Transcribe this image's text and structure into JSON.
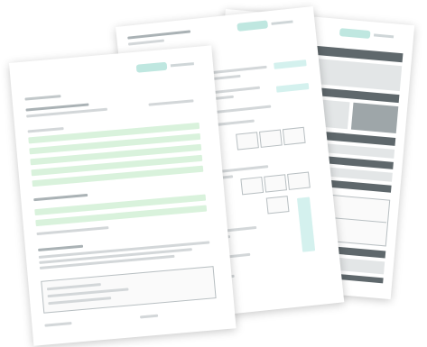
{
  "illustration": {
    "sheets": [
      {
        "id": "back",
        "role": "form-sheet-dark-table"
      },
      {
        "id": "mid",
        "role": "form-sheet-summary"
      },
      {
        "id": "front",
        "role": "form-sheet-green-fields"
      }
    ]
  },
  "colors": {
    "accent_teal": "#bfe7e0",
    "field_green": "#d9f2dc",
    "table_dark": "#5f686c",
    "text_grey": "#d3d7d9"
  }
}
